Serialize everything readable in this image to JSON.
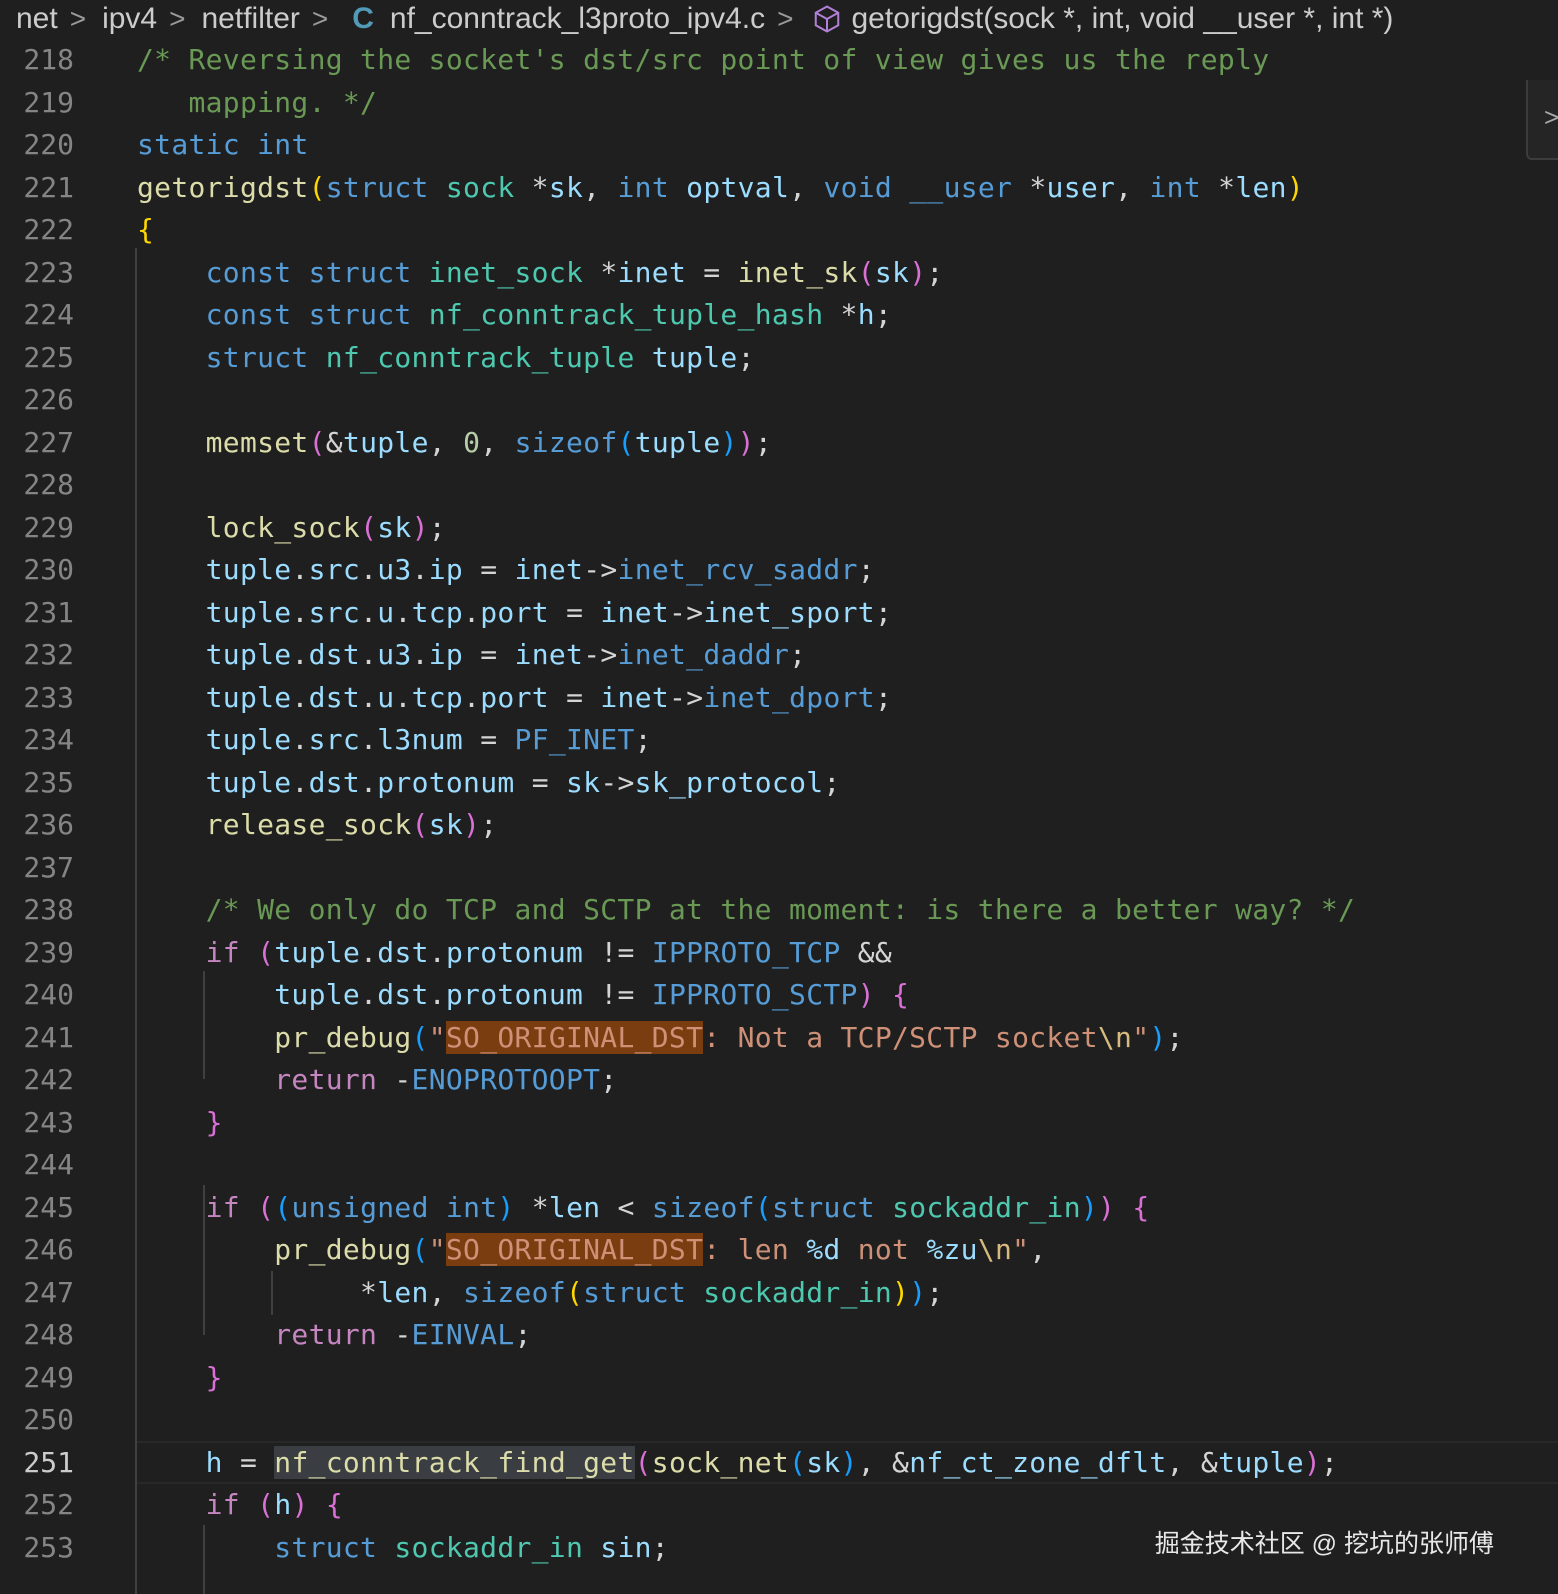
{
  "breadcrumb": {
    "items": [
      "net",
      "ipv4",
      "netfilter"
    ],
    "file": "nf_conntrack_l3proto_ipv4.c",
    "file_icon": "C",
    "symbol": "getorigdst(sock *, int, void __user *, int *)"
  },
  "watermark": "掘金技术社区 @ 挖坑的张师傅",
  "colors": {
    "background": "#1f1f1f",
    "keyword": "#569cd6",
    "type": "#4ec9b0",
    "function": "#dcdcaa",
    "variable": "#9cdcfe",
    "comment": "#6a9955",
    "string": "#ce9178",
    "search_highlight": "#7a3d10"
  },
  "current_line": "251",
  "lines": [
    {
      "n": "218",
      "tokens": [
        [
          "cm",
          "/* Reversing the socket's dst/src point of view gives us the reply"
        ]
      ]
    },
    {
      "n": "219",
      "tokens": [
        [
          "cm",
          "   mapping. */"
        ]
      ]
    },
    {
      "n": "220",
      "tokens": [
        [
          "kw",
          "static"
        ],
        [
          "op",
          " "
        ],
        [
          "kw",
          "int"
        ]
      ]
    },
    {
      "n": "221",
      "tokens": [
        [
          "fn",
          "getorigdst"
        ],
        [
          "p1",
          "("
        ],
        [
          "kw",
          "struct"
        ],
        [
          "op",
          " "
        ],
        [
          "ty",
          "sock"
        ],
        [
          "op",
          " *"
        ],
        [
          "var",
          "sk"
        ],
        [
          "op",
          ", "
        ],
        [
          "kw",
          "int"
        ],
        [
          "op",
          " "
        ],
        [
          "var",
          "optval"
        ],
        [
          "op",
          ", "
        ],
        [
          "kw",
          "void"
        ],
        [
          "op",
          " "
        ],
        [
          "kw",
          "__user"
        ],
        [
          "op",
          " *"
        ],
        [
          "var",
          "user"
        ],
        [
          "op",
          ", "
        ],
        [
          "kw",
          "int"
        ],
        [
          "op",
          " *"
        ],
        [
          "var",
          "len"
        ],
        [
          "p1",
          ")"
        ]
      ]
    },
    {
      "n": "222",
      "tokens": [
        [
          "p1",
          "{"
        ]
      ]
    },
    {
      "n": "223",
      "tokens": [
        [
          "op",
          "    "
        ],
        [
          "kw",
          "const"
        ],
        [
          "op",
          " "
        ],
        [
          "kw",
          "struct"
        ],
        [
          "op",
          " "
        ],
        [
          "ty",
          "inet_sock"
        ],
        [
          "op",
          " *"
        ],
        [
          "var",
          "inet"
        ],
        [
          "op",
          " = "
        ],
        [
          "fn",
          "inet_sk"
        ],
        [
          "p2",
          "("
        ],
        [
          "var",
          "sk"
        ],
        [
          "p2",
          ")"
        ],
        [
          "op",
          ";"
        ]
      ]
    },
    {
      "n": "224",
      "tokens": [
        [
          "op",
          "    "
        ],
        [
          "kw",
          "const"
        ],
        [
          "op",
          " "
        ],
        [
          "kw",
          "struct"
        ],
        [
          "op",
          " "
        ],
        [
          "ty",
          "nf_conntrack_tuple_hash"
        ],
        [
          "op",
          " *"
        ],
        [
          "var",
          "h"
        ],
        [
          "op",
          ";"
        ]
      ]
    },
    {
      "n": "225",
      "tokens": [
        [
          "op",
          "    "
        ],
        [
          "kw",
          "struct"
        ],
        [
          "op",
          " "
        ],
        [
          "ty",
          "nf_conntrack_tuple"
        ],
        [
          "op",
          " "
        ],
        [
          "var",
          "tuple"
        ],
        [
          "op",
          ";"
        ]
      ]
    },
    {
      "n": "226",
      "tokens": []
    },
    {
      "n": "227",
      "tokens": [
        [
          "op",
          "    "
        ],
        [
          "fn",
          "memset"
        ],
        [
          "p2",
          "("
        ],
        [
          "op",
          "&"
        ],
        [
          "var",
          "tuple"
        ],
        [
          "op",
          ", "
        ],
        [
          "num",
          "0"
        ],
        [
          "op",
          ", "
        ],
        [
          "kw",
          "sizeof"
        ],
        [
          "p3",
          "("
        ],
        [
          "var",
          "tuple"
        ],
        [
          "p3",
          ")"
        ],
        [
          "p2",
          ")"
        ],
        [
          "op",
          ";"
        ]
      ]
    },
    {
      "n": "228",
      "tokens": []
    },
    {
      "n": "229",
      "tokens": [
        [
          "op",
          "    "
        ],
        [
          "fn",
          "lock_sock"
        ],
        [
          "p2",
          "("
        ],
        [
          "var",
          "sk"
        ],
        [
          "p2",
          ")"
        ],
        [
          "op",
          ";"
        ]
      ]
    },
    {
      "n": "230",
      "tokens": [
        [
          "op",
          "    "
        ],
        [
          "var",
          "tuple"
        ],
        [
          "op",
          "."
        ],
        [
          "var",
          "src"
        ],
        [
          "op",
          "."
        ],
        [
          "var",
          "u3"
        ],
        [
          "op",
          "."
        ],
        [
          "var",
          "ip"
        ],
        [
          "op",
          " = "
        ],
        [
          "var",
          "inet"
        ],
        [
          "op",
          "->"
        ],
        [
          "mac",
          "inet_rcv_saddr"
        ],
        [
          "op",
          ";"
        ]
      ]
    },
    {
      "n": "231",
      "tokens": [
        [
          "op",
          "    "
        ],
        [
          "var",
          "tuple"
        ],
        [
          "op",
          "."
        ],
        [
          "var",
          "src"
        ],
        [
          "op",
          "."
        ],
        [
          "var",
          "u"
        ],
        [
          "op",
          "."
        ],
        [
          "var",
          "tcp"
        ],
        [
          "op",
          "."
        ],
        [
          "var",
          "port"
        ],
        [
          "op",
          " = "
        ],
        [
          "var",
          "inet"
        ],
        [
          "op",
          "->"
        ],
        [
          "var",
          "inet_sport"
        ],
        [
          "op",
          ";"
        ]
      ]
    },
    {
      "n": "232",
      "tokens": [
        [
          "op",
          "    "
        ],
        [
          "var",
          "tuple"
        ],
        [
          "op",
          "."
        ],
        [
          "var",
          "dst"
        ],
        [
          "op",
          "."
        ],
        [
          "var",
          "u3"
        ],
        [
          "op",
          "."
        ],
        [
          "var",
          "ip"
        ],
        [
          "op",
          " = "
        ],
        [
          "var",
          "inet"
        ],
        [
          "op",
          "->"
        ],
        [
          "mac",
          "inet_daddr"
        ],
        [
          "op",
          ";"
        ]
      ]
    },
    {
      "n": "233",
      "tokens": [
        [
          "op",
          "    "
        ],
        [
          "var",
          "tuple"
        ],
        [
          "op",
          "."
        ],
        [
          "var",
          "dst"
        ],
        [
          "op",
          "."
        ],
        [
          "var",
          "u"
        ],
        [
          "op",
          "."
        ],
        [
          "var",
          "tcp"
        ],
        [
          "op",
          "."
        ],
        [
          "var",
          "port"
        ],
        [
          "op",
          " = "
        ],
        [
          "var",
          "inet"
        ],
        [
          "op",
          "->"
        ],
        [
          "mac",
          "inet_dport"
        ],
        [
          "op",
          ";"
        ]
      ]
    },
    {
      "n": "234",
      "tokens": [
        [
          "op",
          "    "
        ],
        [
          "var",
          "tuple"
        ],
        [
          "op",
          "."
        ],
        [
          "var",
          "src"
        ],
        [
          "op",
          "."
        ],
        [
          "var",
          "l3num"
        ],
        [
          "op",
          " = "
        ],
        [
          "mac",
          "PF_INET"
        ],
        [
          "op",
          ";"
        ]
      ]
    },
    {
      "n": "235",
      "tokens": [
        [
          "op",
          "    "
        ],
        [
          "var",
          "tuple"
        ],
        [
          "op",
          "."
        ],
        [
          "var",
          "dst"
        ],
        [
          "op",
          "."
        ],
        [
          "var",
          "protonum"
        ],
        [
          "op",
          " = "
        ],
        [
          "var",
          "sk"
        ],
        [
          "op",
          "->"
        ],
        [
          "var",
          "sk_protocol"
        ],
        [
          "op",
          ";"
        ]
      ]
    },
    {
      "n": "236",
      "tokens": [
        [
          "op",
          "    "
        ],
        [
          "fn",
          "release_sock"
        ],
        [
          "p2",
          "("
        ],
        [
          "var",
          "sk"
        ],
        [
          "p2",
          ")"
        ],
        [
          "op",
          ";"
        ]
      ]
    },
    {
      "n": "237",
      "tokens": []
    },
    {
      "n": "238",
      "tokens": [
        [
          "op",
          "    "
        ],
        [
          "cm",
          "/* We only do TCP and SCTP at the moment: is there a better way? */"
        ]
      ]
    },
    {
      "n": "239",
      "tokens": [
        [
          "op",
          "    "
        ],
        [
          "ctl",
          "if"
        ],
        [
          "op",
          " "
        ],
        [
          "p2",
          "("
        ],
        [
          "var",
          "tuple"
        ],
        [
          "op",
          "."
        ],
        [
          "var",
          "dst"
        ],
        [
          "op",
          "."
        ],
        [
          "var",
          "protonum"
        ],
        [
          "op",
          " != "
        ],
        [
          "mac",
          "IPPROTO_TCP"
        ],
        [
          "op",
          " &&"
        ]
      ]
    },
    {
      "n": "240",
      "tokens": [
        [
          "op",
          "        "
        ],
        [
          "var",
          "tuple"
        ],
        [
          "op",
          "."
        ],
        [
          "var",
          "dst"
        ],
        [
          "op",
          "."
        ],
        [
          "var",
          "protonum"
        ],
        [
          "op",
          " != "
        ],
        [
          "mac",
          "IPPROTO_SCTP"
        ],
        [
          "p2",
          ")"
        ],
        [
          "op",
          " "
        ],
        [
          "p2",
          "{"
        ]
      ]
    },
    {
      "n": "241",
      "tokens": [
        [
          "op",
          "        "
        ],
        [
          "fn",
          "pr_debug"
        ],
        [
          "p3",
          "("
        ],
        [
          "str",
          "\""
        ],
        [
          "str hl-o",
          "SO_ORIGINAL_DST"
        ],
        [
          "str",
          ": Not a TCP/SCTP socket"
        ],
        [
          "esc",
          "\\n"
        ],
        [
          "str",
          "\""
        ],
        [
          "p3",
          ")"
        ],
        [
          "op",
          ";"
        ]
      ]
    },
    {
      "n": "242",
      "tokens": [
        [
          "op",
          "        "
        ],
        [
          "ctl",
          "return"
        ],
        [
          "op",
          " -"
        ],
        [
          "mac",
          "ENOPROTOOPT"
        ],
        [
          "op",
          ";"
        ]
      ]
    },
    {
      "n": "243",
      "tokens": [
        [
          "op",
          "    "
        ],
        [
          "p2",
          "}"
        ]
      ]
    },
    {
      "n": "244",
      "tokens": []
    },
    {
      "n": "245",
      "tokens": [
        [
          "op",
          "    "
        ],
        [
          "ctl",
          "if"
        ],
        [
          "op",
          " "
        ],
        [
          "p2",
          "("
        ],
        [
          "p3",
          "("
        ],
        [
          "kw",
          "unsigned"
        ],
        [
          "op",
          " "
        ],
        [
          "kw",
          "int"
        ],
        [
          "p3",
          ")"
        ],
        [
          "op",
          " *"
        ],
        [
          "var",
          "len"
        ],
        [
          "op",
          " < "
        ],
        [
          "kw",
          "sizeof"
        ],
        [
          "p3",
          "("
        ],
        [
          "kw",
          "struct"
        ],
        [
          "op",
          " "
        ],
        [
          "ty",
          "sockaddr_in"
        ],
        [
          "p3",
          ")"
        ],
        [
          "p2",
          ")"
        ],
        [
          "op",
          " "
        ],
        [
          "p2",
          "{"
        ]
      ]
    },
    {
      "n": "246",
      "tokens": [
        [
          "op",
          "        "
        ],
        [
          "fn",
          "pr_debug"
        ],
        [
          "p3",
          "("
        ],
        [
          "str",
          "\""
        ],
        [
          "str hl-o",
          "SO_ORIGINAL_DST"
        ],
        [
          "str",
          ": len "
        ],
        [
          "var",
          "%d"
        ],
        [
          "str",
          " not "
        ],
        [
          "var",
          "%zu"
        ],
        [
          "esc",
          "\\n"
        ],
        [
          "str",
          "\""
        ],
        [
          "op",
          ","
        ]
      ]
    },
    {
      "n": "247",
      "tokens": [
        [
          "op",
          "             *"
        ],
        [
          "var",
          "len"
        ],
        [
          "op",
          ", "
        ],
        [
          "kw",
          "sizeof"
        ],
        [
          "p1",
          "("
        ],
        [
          "kw",
          "struct"
        ],
        [
          "op",
          " "
        ],
        [
          "ty",
          "sockaddr_in"
        ],
        [
          "p1",
          ")"
        ],
        [
          "p3",
          ")"
        ],
        [
          "op",
          ";"
        ]
      ]
    },
    {
      "n": "248",
      "tokens": [
        [
          "op",
          "        "
        ],
        [
          "ctl",
          "return"
        ],
        [
          "op",
          " -"
        ],
        [
          "mac",
          "EINVAL"
        ],
        [
          "op",
          ";"
        ]
      ]
    },
    {
      "n": "249",
      "tokens": [
        [
          "op",
          "    "
        ],
        [
          "p2",
          "}"
        ]
      ]
    },
    {
      "n": "250",
      "tokens": []
    },
    {
      "n": "251",
      "tokens": [
        [
          "op",
          "    "
        ],
        [
          "var",
          "h"
        ],
        [
          "op",
          " = "
        ],
        [
          "fn hl-g",
          "nf_conntrack_find_get"
        ],
        [
          "p2",
          "("
        ],
        [
          "fn",
          "sock_net"
        ],
        [
          "p3",
          "("
        ],
        [
          "var",
          "sk"
        ],
        [
          "p3",
          ")"
        ],
        [
          "op",
          ", &"
        ],
        [
          "var",
          "nf_ct_zone_dflt"
        ],
        [
          "op",
          ", &"
        ],
        [
          "var",
          "tuple"
        ],
        [
          "p2",
          ")"
        ],
        [
          "op",
          ";"
        ]
      ]
    },
    {
      "n": "252",
      "tokens": [
        [
          "op",
          "    "
        ],
        [
          "ctl",
          "if"
        ],
        [
          "op",
          " "
        ],
        [
          "p2",
          "("
        ],
        [
          "var",
          "h"
        ],
        [
          "p2",
          ")"
        ],
        [
          "op",
          " "
        ],
        [
          "p2",
          "{"
        ]
      ]
    },
    {
      "n": "253",
      "tokens": [
        [
          "op",
          "        "
        ],
        [
          "kw",
          "struct"
        ],
        [
          "op",
          " "
        ],
        [
          "ty",
          "sockaddr_in"
        ],
        [
          "op",
          " "
        ],
        [
          "var",
          "sin"
        ],
        [
          "op",
          ";"
        ]
      ]
    }
  ]
}
